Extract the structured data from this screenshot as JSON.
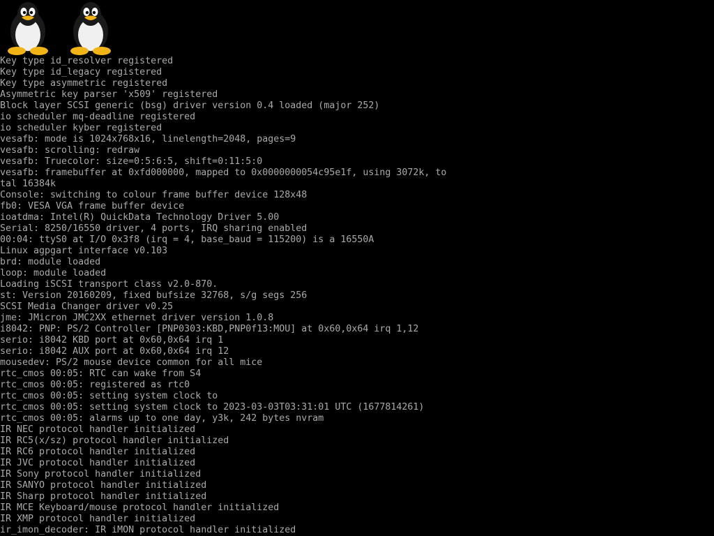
{
  "colors": {
    "background": "#000000",
    "text": "#aaaaaa",
    "tux_body": "#1a1a1a",
    "tux_belly": "#f0f0f0",
    "tux_feet": "#f2b417"
  },
  "logos": [
    {
      "icon": "tux-penguin-icon"
    },
    {
      "icon": "tux-penguin-icon"
    }
  ],
  "console": {
    "lines": [
      "Key type id_resolver registered",
      "Key type id_legacy registered",
      "Key type asymmetric registered",
      "Asymmetric key parser 'x509' registered",
      "Block layer SCSI generic (bsg) driver version 0.4 loaded (major 252)",
      "io scheduler mq-deadline registered",
      "io scheduler kyber registered",
      "vesafb: mode is 1024x768x16, linelength=2048, pages=9",
      "vesafb: scrolling: redraw",
      "vesafb: Truecolor: size=0:5:6:5, shift=0:11:5:0",
      "vesafb: framebuffer at 0xfd000000, mapped to 0x0000000054c95e1f, using 3072k, to",
      "tal 16384k",
      "Console: switching to colour frame buffer device 128x48",
      "fb0: VESA VGA frame buffer device",
      "ioatdma: Intel(R) QuickData Technology Driver 5.00",
      "Serial: 8250/16550 driver, 4 ports, IRQ sharing enabled",
      "00:04: ttyS0 at I/O 0x3f8 (irq = 4, base_baud = 115200) is a 16550A",
      "Linux agpgart interface v0.103",
      "brd: module loaded",
      "loop: module loaded",
      "Loading iSCSI transport class v2.0-870.",
      "st: Version 20160209, fixed bufsize 32768, s/g segs 256",
      "SCSI Media Changer driver v0.25",
      "jme: JMicron JMC2XX ethernet driver version 1.0.8",
      "i8042: PNP: PS/2 Controller [PNP0303:KBD,PNP0f13:MOU] at 0x60,0x64 irq 1,12",
      "serio: i8042 KBD port at 0x60,0x64 irq 1",
      "serio: i8042 AUX port at 0x60,0x64 irq 12",
      "mousedev: PS/2 mouse device common for all mice",
      "rtc_cmos 00:05: RTC can wake from S4",
      "rtc_cmos 00:05: registered as rtc0",
      "rtc_cmos 00:05: setting system clock to",
      "rtc_cmos 00:05: setting system clock to 2023-03-03T03:31:01 UTC (1677814261)",
      "rtc_cmos 00:05: alarms up to one day, y3k, 242 bytes nvram",
      "IR NEC protocol handler initialized",
      "IR RC5(x/sz) protocol handler initialized",
      "IR RC6 protocol handler initialized",
      "IR JVC protocol handler initialized",
      "IR Sony protocol handler initialized",
      "IR SANYO protocol handler initialized",
      "IR Sharp protocol handler initialized",
      "IR MCE Keyboard/mouse protocol handler initialized",
      "IR XMP protocol handler initialized",
      "ir_imon_decoder: IR iMON protocol handler initialized"
    ]
  }
}
